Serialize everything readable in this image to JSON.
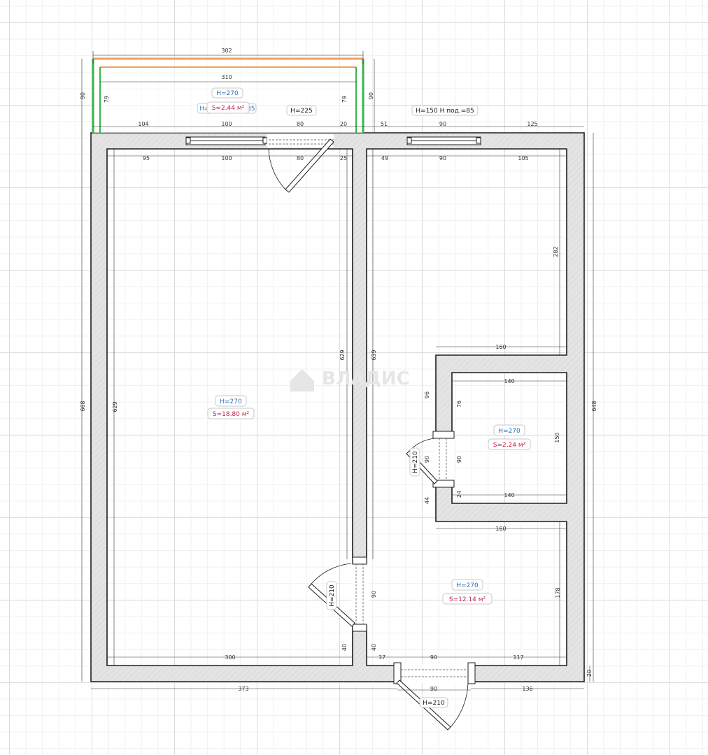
{
  "colors": {
    "height_label": "#2d6fb7",
    "area_label": "#c2254a",
    "wall_fill": "#e4e4e4",
    "wall_stroke": "#1e1e1e",
    "balcony_glazing": "#f0a060",
    "balcony_side": "#39b54a",
    "watermark": "#e6e6e6"
  },
  "watermark": {
    "text": "ВЛАДИС",
    "icon": "house-logo-icon"
  },
  "rooms": {
    "balcony": {
      "height": "H=270",
      "area": "S=2.44 м²",
      "extra": "H=1",
      "extra_tail": "35"
    },
    "living": {
      "height": "H=270",
      "area": "S=18.80 м²"
    },
    "bathroom": {
      "height": "H=270",
      "area": "S=2.24 м²"
    },
    "kitchen": {
      "height": "H=270",
      "area": "S=12.14 м²"
    }
  },
  "openings": {
    "balcony_door": "H=225",
    "kitchen_window": "H=150  H под.=85",
    "bathroom_door": "H=210",
    "living_door": "H=210",
    "entrance_door": "H=210"
  },
  "dimensions": {
    "balcony_outer_width": "302",
    "balcony_inner_width": "310",
    "balcony_depth_left": "90",
    "balcony_depth_inner_left": "79",
    "balcony_depth_inner_right": "79",
    "balcony_depth_right": "90",
    "top_seg_104": "104",
    "top_seg_100": "100",
    "top_seg_80": "80",
    "top_seg_20": "20",
    "top_seg_51": "51",
    "top_seg_90": "90",
    "top_seg_125": "125",
    "inner_seg_95": "95",
    "inner_seg_100": "100",
    "inner_seg_80": "80",
    "inner_seg_25": "25",
    "inner_seg_49": "49",
    "inner_seg_90": "90",
    "inner_seg_105": "105",
    "left_outer": "668",
    "left_inner": "629",
    "partition_left": "629",
    "partition_right": "639",
    "right_outer": "648",
    "kitchen_right_upper": "282",
    "bath_top_outer": "160",
    "bath_top_inner": "140",
    "bath_bottom_inner": "140",
    "bath_bottom_outer": "160",
    "bath_right": "150",
    "bath_left_upper": "96",
    "bath_left_upper_inner": "76",
    "bath_door_width": "90",
    "bath_door_width_inner": "90",
    "bath_left_lower": "44",
    "bath_left_lower_inner": "24",
    "kitchen_right_lower": "178",
    "corridor_door_width": "90",
    "corridor_bottom_left": "40",
    "corridor_bottom_right": "40",
    "living_bottom": "300",
    "bottom_seg_37": "37",
    "bottom_seg_90": "90",
    "bottom_seg_117": "117",
    "outer_bottom_373": "373",
    "outer_bottom_136": "136",
    "entrance_width": "90",
    "bottom_right_20": "20"
  }
}
